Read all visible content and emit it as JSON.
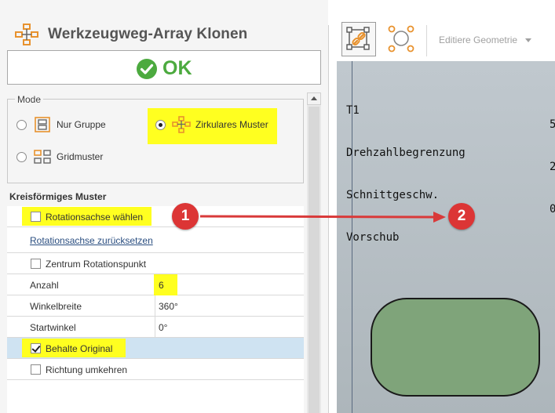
{
  "header": {
    "title": "Werkzeugweg-Array Klonen",
    "icon": "array-clone-icon"
  },
  "ok_button": {
    "label": "OK",
    "icon": "check-circle-icon"
  },
  "mode": {
    "legend": "Mode",
    "options": [
      {
        "label": "Nur Gruppe",
        "icon": "group-icon",
        "selected": false
      },
      {
        "label": "Zirkulares Muster",
        "icon": "circular-pattern-icon",
        "selected": true
      },
      {
        "label": "Gridmuster",
        "icon": "grid-pattern-icon",
        "selected": false
      }
    ]
  },
  "properties": {
    "section_title": "Kreisförmiges Muster",
    "rotation_axis": {
      "label": "Rotationsachse wählen",
      "checked": false
    },
    "reset_axis": {
      "label": "Rotationsachse zurücksetzen"
    },
    "center_point": {
      "label": "Zentrum Rotationspunkt",
      "checked": false
    },
    "count": {
      "label": "Anzahl",
      "value": "6"
    },
    "angle_width": {
      "label": "Winkelbreite",
      "value": "360°"
    },
    "start_angle": {
      "label": "Startwinkel",
      "value": "0°"
    },
    "keep_original": {
      "label": "Behalte Original",
      "checked": true
    },
    "reverse_direction": {
      "label": "Richtung umkehren",
      "checked": false
    }
  },
  "toolbar": {
    "buttons": [
      {
        "icon": "link-geometry-icon",
        "active": true
      },
      {
        "icon": "nodes-icon",
        "active": false
      }
    ],
    "dropdown_label": "Editiere Geometrie"
  },
  "canvas": {
    "lines": [
      "T1",
      "Drehzahlbegrenzung",
      "Schnittgeschw.",
      "Vorschub"
    ],
    "values": [
      "5",
      "2",
      "0"
    ]
  },
  "annotations": {
    "marker_1": "1",
    "marker_2": "2"
  },
  "colors": {
    "accent_orange": "#e8922e",
    "highlight": "#ffff20",
    "ok_green": "#4caa3f",
    "marker_red": "#dc3535"
  }
}
